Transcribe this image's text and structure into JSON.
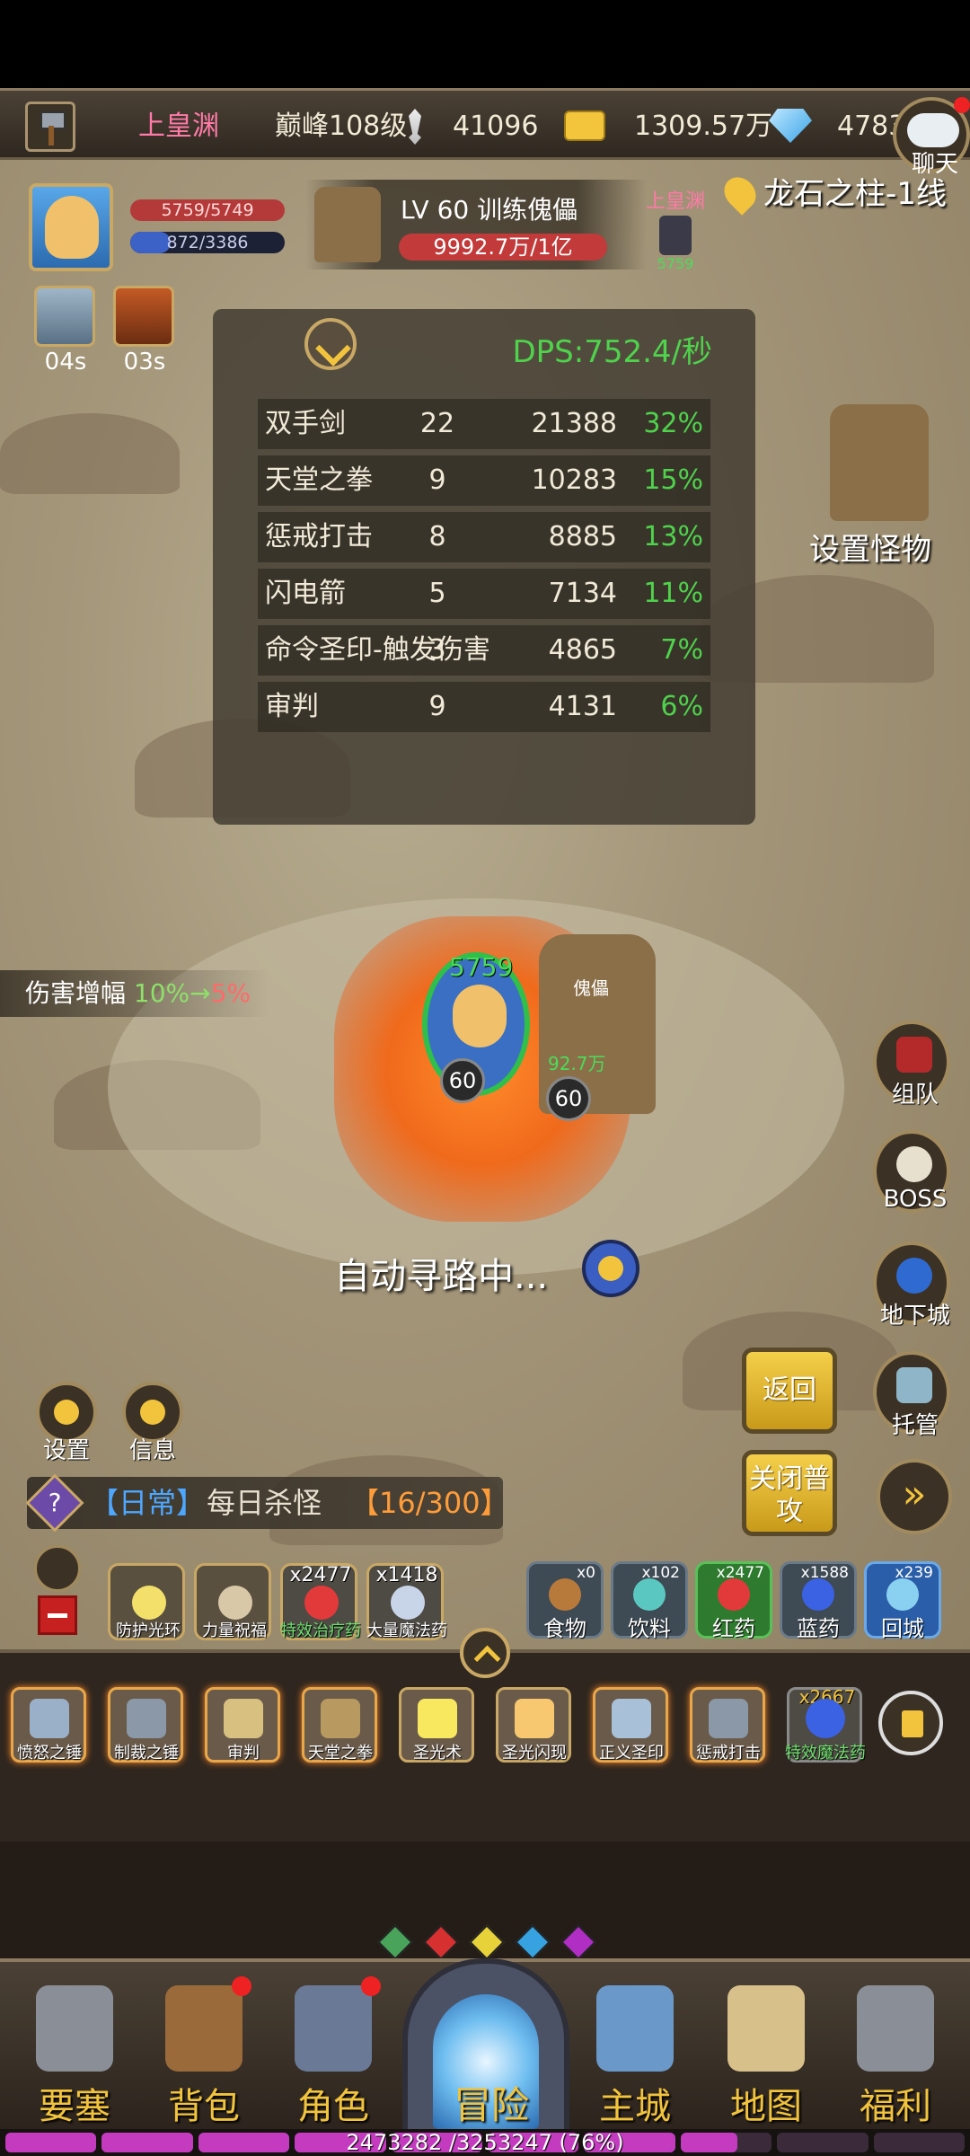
{
  "status_bar": {
    "player_name": "上皇渊",
    "peak_level": "巅峰108级",
    "power": "41096",
    "gold": "1309.57万",
    "diamonds": "4783",
    "chat_label": "聊天"
  },
  "player": {
    "hp": "5759/5749",
    "mp": "872/3386",
    "mp_fraction": 0.26
  },
  "target": {
    "name": "LV 60 训练傀儡",
    "hp": "9992.7万/1亿"
  },
  "pk_badge": {
    "name": "上皇渊",
    "value": "5759"
  },
  "location": "龙石之柱-1线",
  "buffs": [
    {
      "timer": "04s"
    },
    {
      "timer": "03s"
    }
  ],
  "dps_panel": {
    "dps": "DPS:752.4/秒",
    "rows": [
      {
        "skill": "双手剑",
        "hits": "22",
        "damage": "21388",
        "percent": "32%"
      },
      {
        "skill": "天堂之拳",
        "hits": "9",
        "damage": "10283",
        "percent": "15%"
      },
      {
        "skill": "惩戒打击",
        "hits": "8",
        "damage": "8885",
        "percent": "13%"
      },
      {
        "skill": "闪电箭",
        "hits": "5",
        "damage": "7134",
        "percent": "11%"
      },
      {
        "skill": "命令圣印-触发伤害",
        "hits": "3",
        "damage": "4865",
        "percent": "7%"
      },
      {
        "skill": "审判",
        "hits": "9",
        "damage": "4131",
        "percent": "6%"
      }
    ]
  },
  "set_monster_label": "设置怪物",
  "damage_boost": {
    "label": "伤害增幅",
    "from": "10%",
    "arrow": "→",
    "to": "5%"
  },
  "combat": {
    "hero_hp": "5759",
    "hero_level": "60",
    "golem_level": "60",
    "golem_name": "傀儡",
    "golem_hp": "92.7万"
  },
  "auto_path": "自动寻路中...",
  "right_buttons": {
    "team": "组队",
    "boss": "BOSS",
    "dungeon": "地下城",
    "auto": "托管"
  },
  "action_buttons": {
    "back": "返回",
    "close_attack": "关闭普攻"
  },
  "left_buttons": {
    "settings": "设置",
    "info": "信息"
  },
  "quest": {
    "tag": "【日常】",
    "text": "每日杀怪",
    "count": "【16/300】"
  },
  "quick_slots": [
    {
      "label": "防护光环",
      "count": ""
    },
    {
      "label": "力量祝福",
      "count": ""
    },
    {
      "label": "特效治疗药",
      "count": "x2477"
    },
    {
      "label": "大量魔法药",
      "count": "x1418"
    }
  ],
  "item_slots": [
    {
      "label": "食物",
      "count": "x0"
    },
    {
      "label": "饮料",
      "count": "x102"
    },
    {
      "label": "红药",
      "count": "x2477"
    },
    {
      "label": "蓝药",
      "count": "x1588"
    },
    {
      "label": "回城",
      "count": "x239"
    }
  ],
  "skills": [
    {
      "label": "愤怒之锤",
      "count": ""
    },
    {
      "label": "制裁之锤",
      "count": ""
    },
    {
      "label": "审判",
      "count": ""
    },
    {
      "label": "天堂之拳",
      "count": ""
    },
    {
      "label": "圣光术",
      "count": ""
    },
    {
      "label": "圣光闪现",
      "count": ""
    },
    {
      "label": "正义圣印",
      "count": ""
    },
    {
      "label": "惩戒打击",
      "count": ""
    },
    {
      "label": "特效魔法药",
      "count": "x2667"
    }
  ],
  "gem_colors": [
    "#4aa35a",
    "#d63030",
    "#e8d23a",
    "#36a3e0",
    "#b02ec4"
  ],
  "nav": {
    "fortress": "要塞",
    "bag": "背包",
    "character": "角色",
    "adventure": "冒险",
    "city": "主城",
    "map": "地图",
    "welfare": "福利"
  },
  "exp": {
    "text": "2473282 /3253247 (76%)",
    "fraction": 0.76
  }
}
